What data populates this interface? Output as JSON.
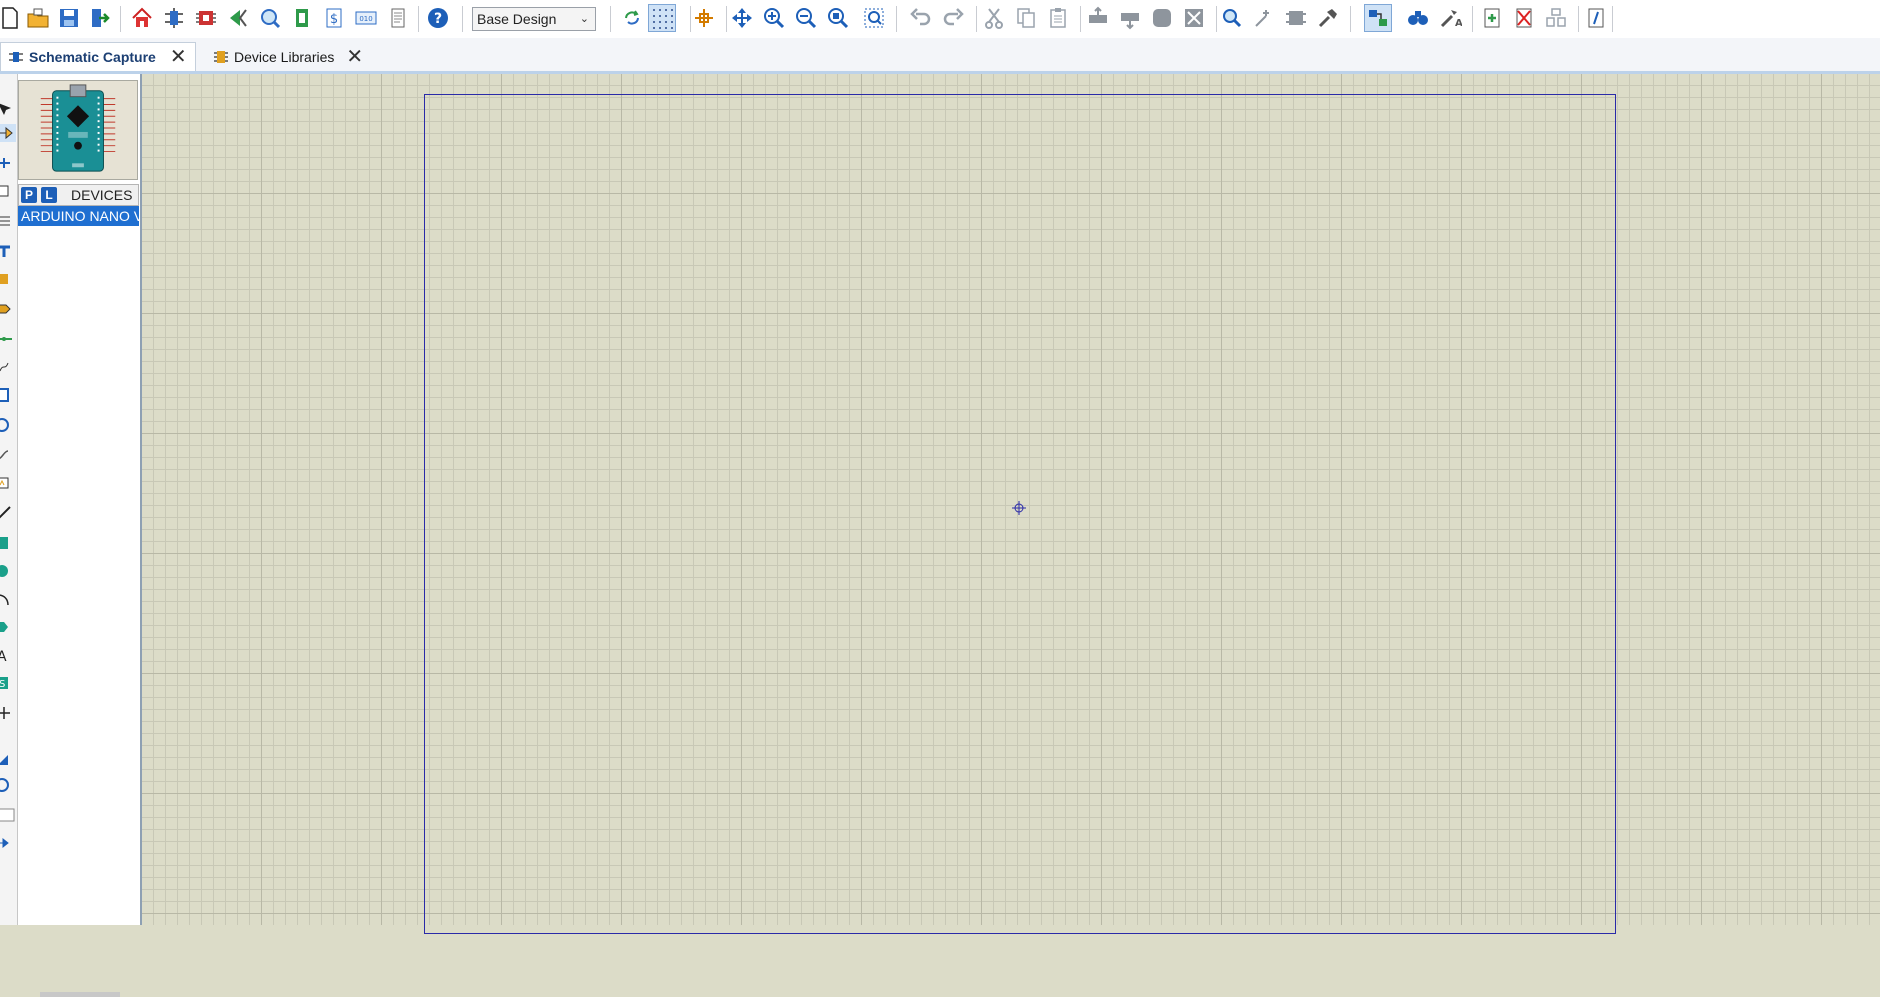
{
  "toolbar": {
    "design_select": "Base Design",
    "icons": [
      "new-file",
      "open-file",
      "save-file",
      "import",
      "home",
      "schematic",
      "pcb",
      "gerber",
      "3d-view",
      "bom",
      "cost",
      "code",
      "notes",
      "help",
      "refresh",
      "grid-toggle",
      "origin",
      "pan",
      "zoom-in",
      "zoom-out",
      "zoom-all",
      "zoom-area",
      "undo",
      "redo",
      "cut",
      "copy",
      "paste",
      "block-copy",
      "block-move",
      "block-rotate",
      "block-delete",
      "pick-device",
      "make-device",
      "packaging",
      "decompose",
      "wire-autorouter",
      "search",
      "property-assign",
      "new-sheet",
      "remove-sheet",
      "exit-to-parent",
      "design-explorer"
    ]
  },
  "tabs": [
    {
      "label": "Schematic Capture",
      "active": true
    },
    {
      "label": "Device Libraries",
      "active": false
    }
  ],
  "object_selector": {
    "p_button": "P",
    "l_button": "L",
    "title": "DEVICES",
    "items": [
      {
        "label": "ARDUINO NANO V",
        "selected": true
      }
    ]
  },
  "colors": {
    "canvas": "#dcdcc8",
    "sheet_border": "#2a2aa8",
    "selection": "#1f6fd1",
    "accent": "#1d5fb8"
  }
}
